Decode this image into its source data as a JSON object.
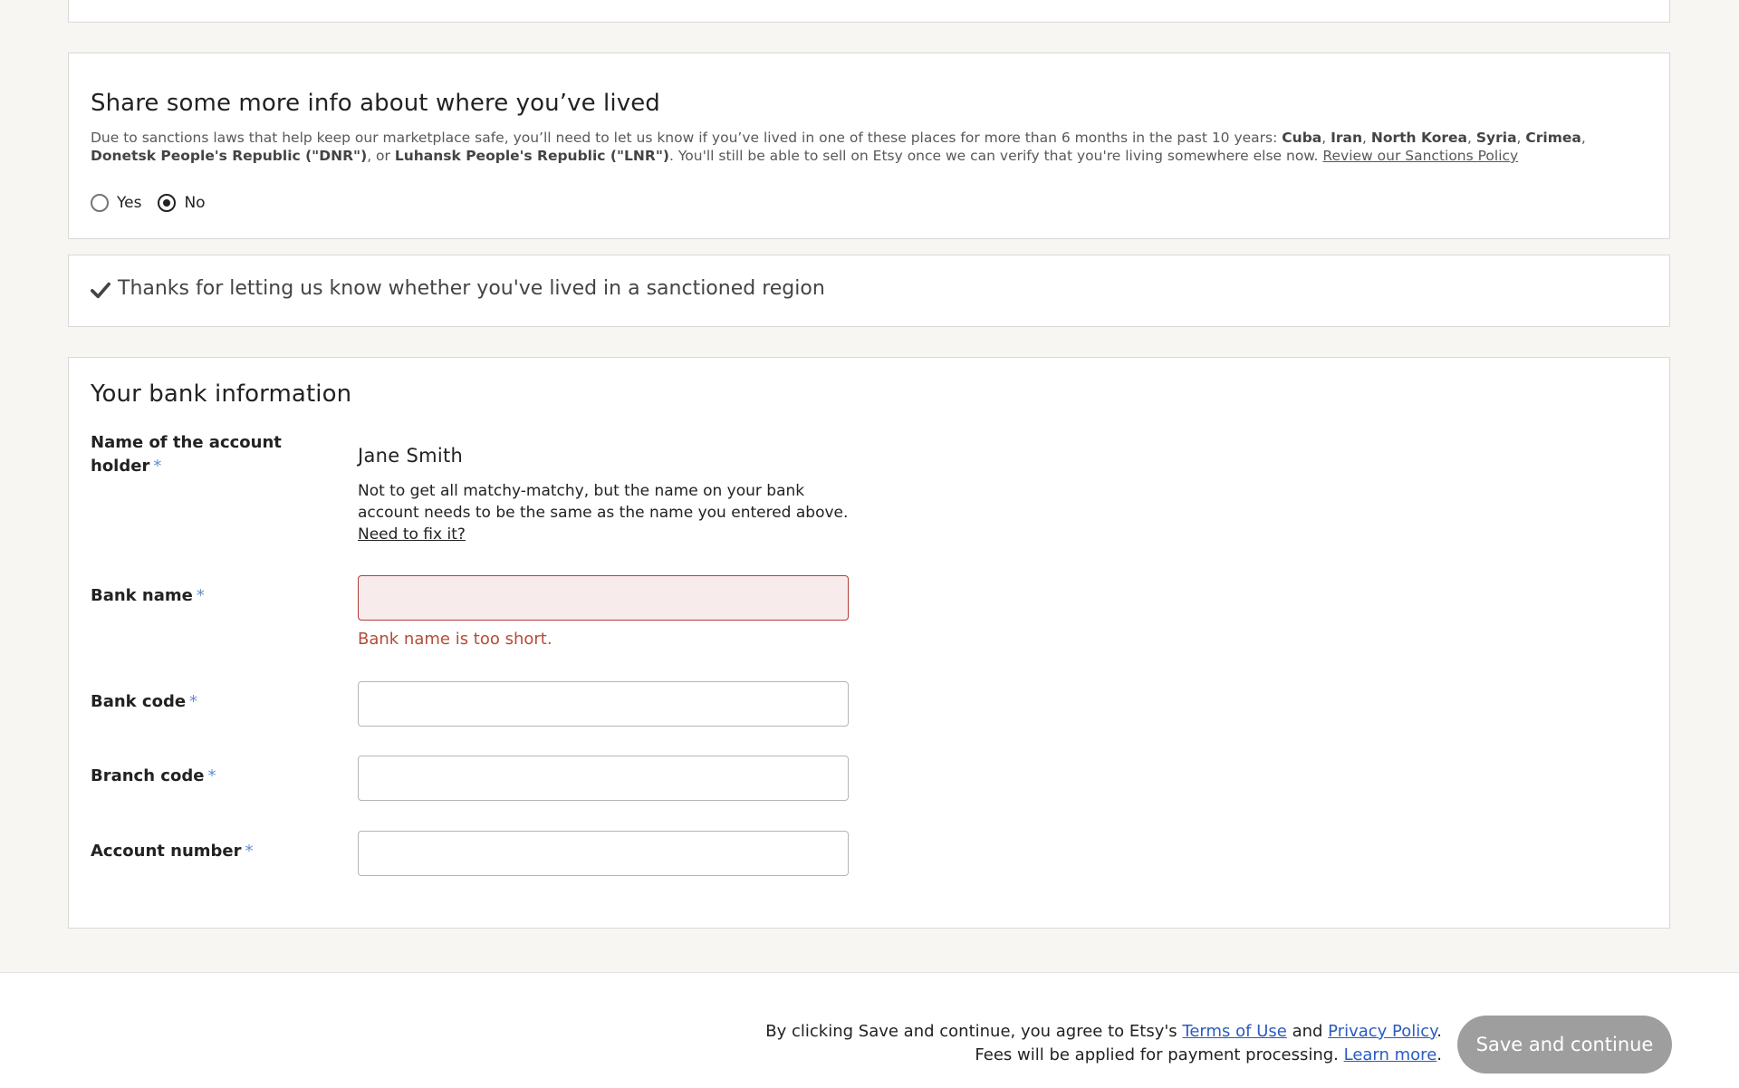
{
  "sanctions": {
    "title": "Share some more info about where you’ve lived",
    "text_intro": "Due to sanctions laws that help keep our marketplace safe, you’ll need to let us know if you’ve lived in one of these places for more than 6 months in the past 10 years: ",
    "regions": [
      "Cuba",
      "Iran",
      "North Korea",
      "Syria",
      "Crimea",
      "Donetsk People's Republic (\"DNR\")",
      "Luhansk People's Republic (\"LNR\")"
    ],
    "sep": ", ",
    "or": ", or ",
    "text_outro": ". You'll still be able to sell on Etsy once we can verify that you're living somewhere else now. ",
    "policy_link": "Review our Sanctions Policy",
    "options": {
      "yes": "Yes",
      "no": "No"
    },
    "selected": "No"
  },
  "confirm": {
    "text": "Thanks for letting us know whether you've lived in a sanctioned region",
    "icon": "check-icon"
  },
  "bank": {
    "title": "Your bank information",
    "required_marker": "*",
    "holder_label": "Name of the account holder",
    "holder_value": "Jane Smith",
    "holder_help": "Not to get all matchy-matchy, but the name on your bank account needs to be the same as the name you entered above.",
    "holder_fix_link": "Need to fix it?",
    "bank_name_label": "Bank name",
    "bank_name_value": "",
    "bank_name_error": "Bank name is too short.",
    "bank_code_label": "Bank code",
    "bank_code_value": "",
    "branch_code_label": "Branch code",
    "branch_code_value": "",
    "account_number_label": "Account number",
    "account_number_value": ""
  },
  "footer": {
    "line1_prefix": "By clicking Save and continue, you agree to Etsy's ",
    "terms_link": "Terms of Use",
    "and": " and ",
    "privacy_link": "Privacy Policy",
    "period": ".",
    "line2_prefix": "Fees will be applied for payment processing. ",
    "learn_more_link": "Learn more",
    "save_button": "Save and continue"
  },
  "colors": {
    "page_bg": "#f7f6f2",
    "error": "#b54b37",
    "link": "#2a5bc1",
    "required": "#5a8fd6",
    "button_disabled": "#9e9e9e"
  }
}
